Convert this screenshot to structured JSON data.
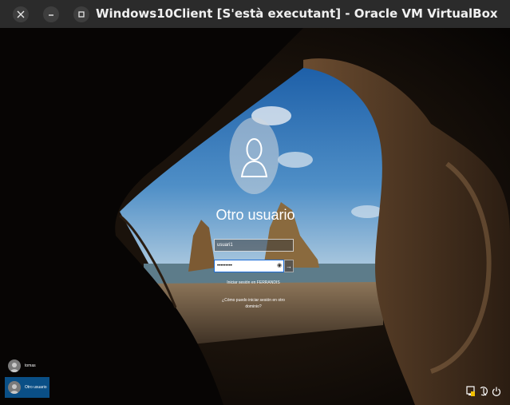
{
  "window": {
    "title": "Windows10Client [S'està executant] - Oracle VM VirtualBox",
    "controls": [
      "close-icon",
      "minimize-icon",
      "maximize-icon"
    ]
  },
  "login": {
    "title": "Otro usuario",
    "username_value": "usuari1",
    "password_mask": "•••••••••",
    "signin_to": "Iniciar sesión en FERRANDIS",
    "help_link": "¿Cómo puedo iniciar sesión en otro dominio?",
    "reveal_icon": "eye-icon",
    "submit_icon": "arrow-right-icon"
  },
  "users": [
    {
      "name": "tomas",
      "selected": false
    },
    {
      "name": "Otro usuario",
      "selected": true
    }
  ],
  "tray": [
    "network-icon",
    "ease-of-access-icon",
    "power-icon"
  ],
  "colors": {
    "selected_user_bg": "#0a4f86",
    "password_border": "#1e6ed8",
    "titlebar_bg": "#2b2b2b"
  }
}
